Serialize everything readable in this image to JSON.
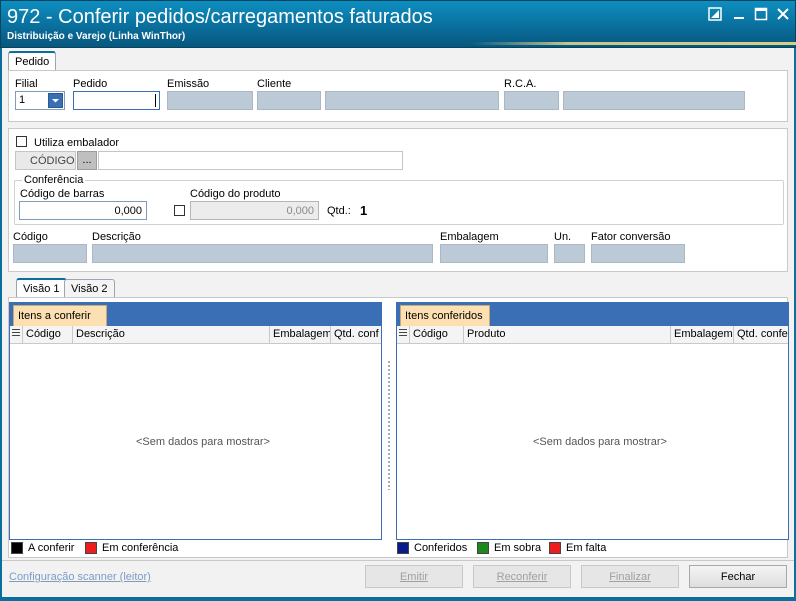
{
  "window": {
    "title": "972 - Conferir pedidos/carregamentos faturados",
    "subtitle": "Distribuição e Varejo (Linha WinThor)"
  },
  "main_tab": "Pedido",
  "header_fields": {
    "filial_label": "Filial",
    "filial_value": "1",
    "pedido_label": "Pedido",
    "emissao_label": "Emissão",
    "cliente_label": "Cliente",
    "rca_label": "R.C.A."
  },
  "embalador": {
    "checkbox_label": "Utiliza embalador",
    "codigo_label": "CÓDIGO",
    "browse_label": "..."
  },
  "conferencia": {
    "group_label": "Conferência",
    "barcode_label": "Código de barras",
    "barcode_value": "0,000",
    "product_code_label": "Código do produto",
    "product_code_value": "0,000",
    "qtd_label": "Qtd.:",
    "qtd_value": "1"
  },
  "product_info": {
    "codigo_label": "Código",
    "descricao_label": "Descrição",
    "embalagem_label": "Embalagem",
    "un_label": "Un.",
    "fator_label": "Fator conversão"
  },
  "view_tabs": [
    "Visão 1",
    "Visão 2"
  ],
  "left_grid": {
    "title": "Itens a conferir",
    "columns": [
      "Código",
      "Descrição",
      "Embalagem",
      "Qtd. conf"
    ],
    "empty_text": "<Sem dados para mostrar>"
  },
  "right_grid": {
    "title": "Itens conferidos",
    "columns": [
      "Código",
      "Produto",
      "Embalagem",
      "Qtd. confe"
    ],
    "empty_text": "<Sem dados para mostrar>"
  },
  "left_legend": [
    {
      "label": "A conferir",
      "color": "#000000"
    },
    {
      "label": "Em conferência",
      "color": "#ee1c1c"
    }
  ],
  "right_legend": [
    {
      "label": "Conferidos",
      "color": "#0a1a8c"
    },
    {
      "label": "Em sobra",
      "color": "#1a8a1a"
    },
    {
      "label": "Em falta",
      "color": "#ee1c1c"
    }
  ],
  "footer": {
    "scanner_link": "Configuração scanner (leitor)",
    "buttons": {
      "emitir": "Emitir",
      "reconferir": "Reconferir",
      "finalizar": "Finalizar",
      "fechar": "Fechar"
    }
  }
}
